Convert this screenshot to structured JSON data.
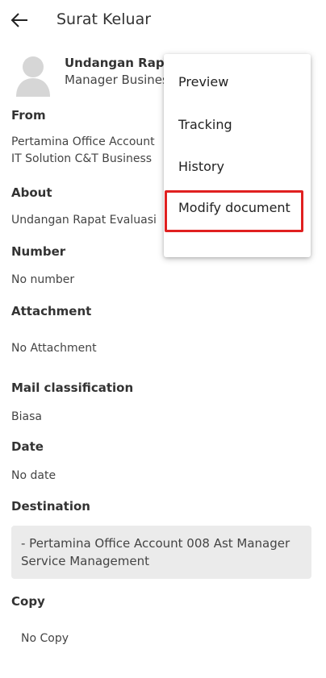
{
  "header": {
    "title": "Surat Keluar"
  },
  "sender": {
    "name": "Undangan Rapat",
    "role": "Manager Business"
  },
  "fields": {
    "from_label": "From",
    "from_line1": "Pertamina Office Account",
    "from_line2": "IT Solution C&T Business",
    "about_label": "About",
    "about_value": "Undangan Rapat Evaluasi",
    "number_label": "Number",
    "number_value": "No number",
    "attachment_label": "Attachment",
    "attachment_value": "No Attachment",
    "classification_label": "Mail classification",
    "classification_value": "Biasa",
    "date_label": "Date",
    "date_value": "No date",
    "destination_label": "Destination",
    "destination_value": "- Pertamina Office Account 008 Ast Manager Service Management",
    "copy_label": "Copy",
    "copy_value": "No Copy"
  },
  "menu": {
    "items": [
      "Preview",
      "Tracking",
      "History",
      "Modify document"
    ]
  },
  "icons": {
    "back": "arrow-left-icon",
    "avatar": "user-avatar-icon"
  },
  "colors": {
    "highlight": "#e02020",
    "destination_bg": "#ebebeb"
  }
}
